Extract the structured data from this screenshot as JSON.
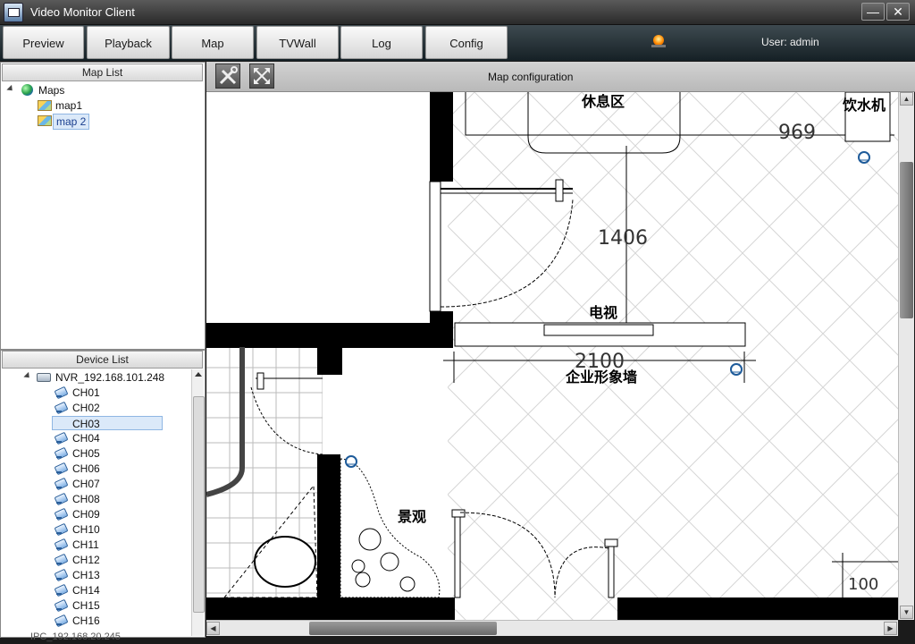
{
  "window": {
    "title": "Video Monitor Client",
    "minimize": "—",
    "close": "✕"
  },
  "nav": {
    "tabs": [
      "Preview",
      "Playback",
      "Map",
      "TVWall",
      "Log",
      "Config"
    ],
    "user_label": "User: admin"
  },
  "map_list": {
    "header": "Map List",
    "root": "Maps",
    "items": [
      "map1",
      "map 2"
    ],
    "selected": "map 2"
  },
  "device_list": {
    "header": "Device List",
    "nvr": "NVR_192.168.101.248",
    "channels": [
      "CH01",
      "CH02",
      "CH03",
      "CH04",
      "CH05",
      "CH06",
      "CH07",
      "CH08",
      "CH09",
      "CH10",
      "CH11",
      "CH12",
      "CH13",
      "CH14",
      "CH15",
      "CH16"
    ],
    "selected": "CH03",
    "next_device": "IPC_192.168.20.245"
  },
  "map_view": {
    "title": "Map configuration",
    "labels": {
      "tv": "电视",
      "wall": "企业形象墙",
      "landscape": "景观",
      "lounge": "休息区",
      "water": "饮水机"
    },
    "dimensions": {
      "d1": "1406",
      "d2": "2100",
      "d3": "969",
      "d4": "100"
    }
  }
}
